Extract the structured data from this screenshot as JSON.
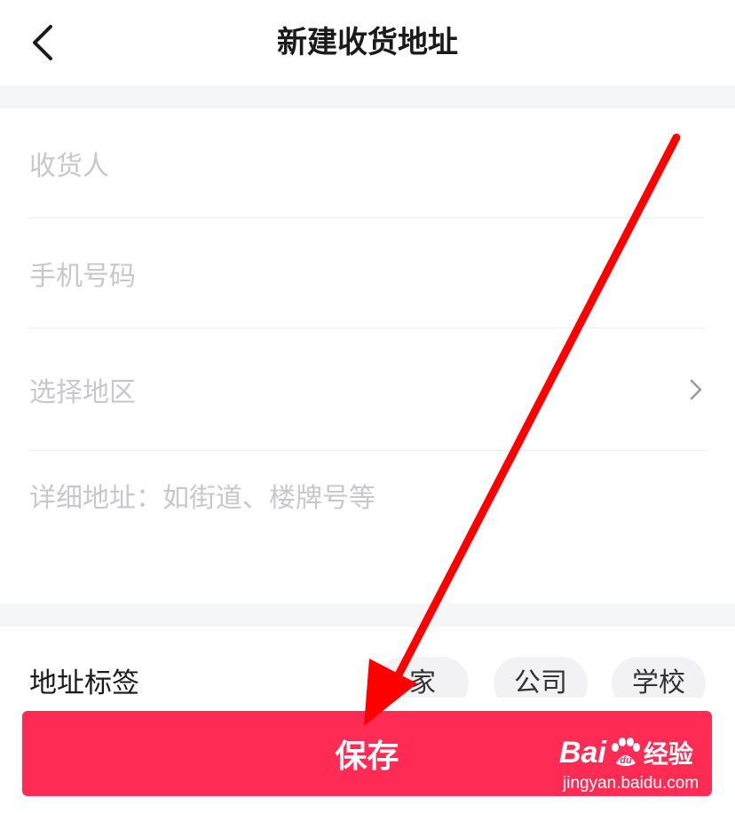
{
  "header": {
    "title": "新建收货地址",
    "back_icon": "chevron-left-icon"
  },
  "form": {
    "recipient_placeholder": "收货人",
    "phone_placeholder": "手机号码",
    "region_placeholder": "选择地区",
    "region_icon": "chevron-right-icon",
    "detail_placeholder": "详细地址：如街道、楼牌号等"
  },
  "tags": {
    "label": "地址标签",
    "options": [
      "家",
      "公司",
      "学校"
    ]
  },
  "save_button": {
    "label": "保存",
    "color": "#fe2c55"
  },
  "watermark": {
    "logo_text": "Bai du 经验",
    "url": "jingyan.baidu.com"
  },
  "annotation": {
    "type": "red-arrow",
    "color": "#ff0000"
  }
}
